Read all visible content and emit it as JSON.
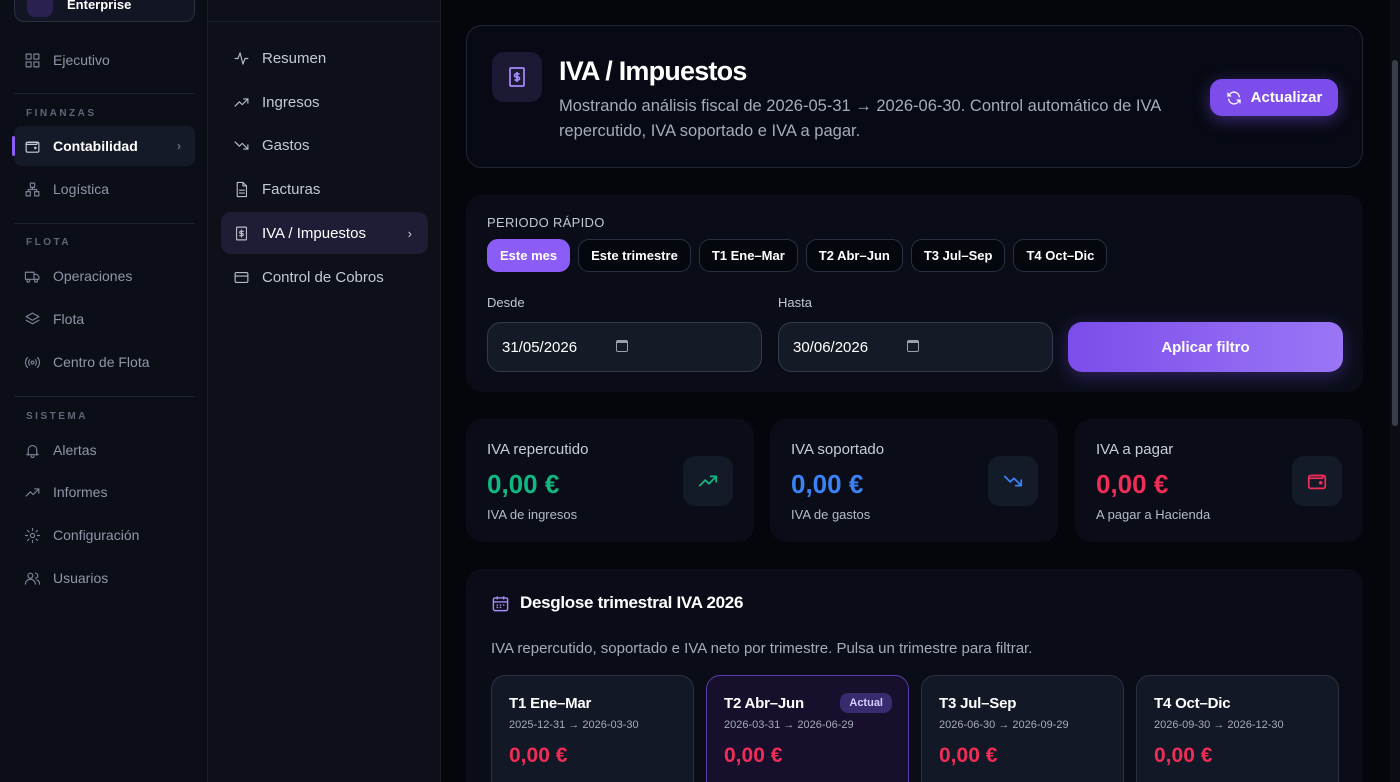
{
  "brand": {
    "name": "Enterprise"
  },
  "sidebar": {
    "items": [
      {
        "label": "Ejecutivo",
        "icon": "grid-icon"
      },
      {
        "label": "Contabilidad",
        "icon": "wallet-icon",
        "active": true
      },
      {
        "label": "Logística",
        "icon": "network-icon"
      },
      {
        "label": "Operaciones",
        "icon": "truck-icon"
      },
      {
        "label": "Flota",
        "icon": "layers-icon"
      },
      {
        "label": "Centro de Flota",
        "icon": "radio-icon"
      },
      {
        "label": "Alertas",
        "icon": "bell-icon"
      },
      {
        "label": "Informes",
        "icon": "trend-icon"
      },
      {
        "label": "Configuración",
        "icon": "gear-icon"
      },
      {
        "label": "Usuarios",
        "icon": "users-icon"
      }
    ],
    "sections": [
      "FINANZAS",
      "FLOTA",
      "SISTEMA"
    ]
  },
  "subnav": {
    "items": [
      {
        "label": "Resumen",
        "icon": "activity-icon"
      },
      {
        "label": "Ingresos",
        "icon": "trend-up-icon"
      },
      {
        "label": "Gastos",
        "icon": "trend-down-icon"
      },
      {
        "label": "Facturas",
        "icon": "file-icon"
      },
      {
        "label": "IVA / Impuestos",
        "icon": "receipt-icon",
        "active": true
      },
      {
        "label": "Control de Cobros",
        "icon": "card-icon"
      }
    ]
  },
  "header": {
    "title": "IVA / Impuestos",
    "description": "Mostrando análisis fiscal de 2026-05-31 → 2026-06-30. Control automático de IVA repercutido, IVA soportado e IVA a pagar.",
    "refresh_label": "Actualizar"
  },
  "filter": {
    "label": "PERIODO RÁPIDO",
    "chips": [
      "Este mes",
      "Este trimestre",
      "T1 Ene–Mar",
      "T2 Abr–Jun",
      "T3 Jul–Sep",
      "T4 Oct–Dic"
    ],
    "from_label": "Desde",
    "from_value": "31/05/2026",
    "to_label": "Hasta",
    "to_value": "30/06/2026",
    "apply_label": "Aplicar filtro"
  },
  "stats": [
    {
      "title": "IVA repercutido",
      "value": "0,00 €",
      "sub": "IVA de ingresos",
      "color": "#10b981",
      "icon": "trend-up-icon"
    },
    {
      "title": "IVA soportado",
      "value": "0,00 €",
      "sub": "IVA de gastos",
      "color": "#3b82f6",
      "icon": "trend-down-icon"
    },
    {
      "title": "IVA a pagar",
      "value": "0,00 €",
      "sub": "A pagar a Hacienda",
      "color": "#ef2d56",
      "icon": "wallet-icon"
    }
  ],
  "breakdown": {
    "title": "Desglose trimestral IVA 2026",
    "description": "IVA repercutido, soportado e IVA neto por trimestre. Pulsa un trimestre para filtrar.",
    "quarters": [
      {
        "name": "T1 Ene–Mar",
        "range": "2025-12-31 → 2026-03-30",
        "value": "0,00 €"
      },
      {
        "name": "T2 Abr–Jun",
        "range": "2026-03-31 → 2026-06-29",
        "value": "0,00 €",
        "badge": "Actual"
      },
      {
        "name": "T3 Jul–Sep",
        "range": "2026-06-30 → 2026-09-29",
        "value": "0,00 €"
      },
      {
        "name": "T4 Oct–Dic",
        "range": "2026-09-30 → 2026-12-30",
        "value": "0,00 €"
      }
    ]
  },
  "colors": {
    "accent": "#8b5cf6",
    "positive": "#10b981",
    "info": "#3b82f6",
    "negative": "#ef2d56"
  }
}
